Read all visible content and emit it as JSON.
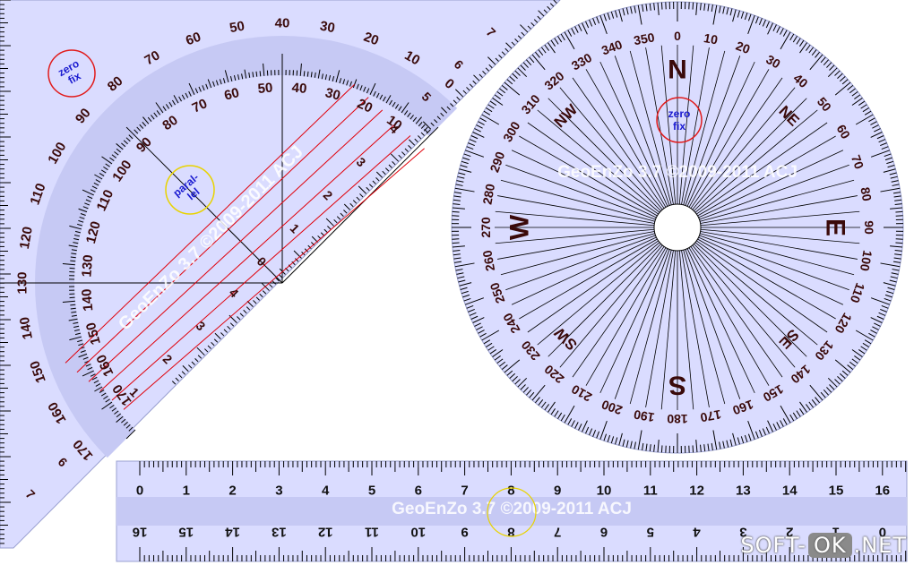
{
  "watermark": "GeoEnZo 3.7 ©2009-2011 ACJ",
  "site_badge": {
    "prefix": "SOFT-",
    "middle": "OK",
    "suffix": ".NET"
  },
  "buttons": {
    "zero_fix": [
      "zero",
      "fix"
    ],
    "parallel": [
      "paral-",
      "lel"
    ]
  },
  "compass": {
    "cardinals": [
      "N",
      "E",
      "S",
      "W"
    ],
    "intercardinals": [
      "NE",
      "SE",
      "SW",
      "NW"
    ],
    "degree_labels": [
      "0",
      "10",
      "20",
      "30",
      "40",
      "50",
      "60",
      "70",
      "80",
      "90",
      "100",
      "110",
      "120",
      "130",
      "140",
      "150",
      "160",
      "170",
      "180",
      "190",
      "200",
      "210",
      "220",
      "230",
      "240",
      "250",
      "260",
      "270",
      "280",
      "290",
      "300",
      "310",
      "320",
      "330",
      "340",
      "350"
    ]
  },
  "triangle": {
    "outer_scale": [
      "0",
      "10",
      "20",
      "30",
      "40",
      "50",
      "60",
      "70",
      "80",
      "90",
      "100",
      "110",
      "120",
      "130",
      "140",
      "150",
      "160",
      "170"
    ],
    "inner_scale": [
      "10",
      "20",
      "30",
      "40",
      "50",
      "60",
      "70",
      "80",
      "90",
      "100",
      "110",
      "120",
      "130",
      "140",
      "150",
      "160",
      "170"
    ],
    "edge_scale_top": [
      "7",
      "6",
      "5"
    ],
    "edge_scale_left": [
      "6",
      "7"
    ],
    "parallel_scale_a": [
      "0",
      "1",
      "2",
      "3",
      "4"
    ],
    "parallel_scale_b": [
      "1",
      "2",
      "3",
      "4"
    ]
  },
  "ruler": {
    "top_labels": [
      "0",
      "1",
      "2",
      "3",
      "4",
      "5",
      "6",
      "7",
      "8",
      "9",
      "10",
      "11",
      "12",
      "13",
      "14",
      "15",
      "16"
    ],
    "bottom_labels": [
      "16",
      "15",
      "14",
      "13",
      "12",
      "11",
      "10",
      "9",
      "8",
      "7",
      "6",
      "5",
      "4",
      "3",
      "2",
      "1",
      "0"
    ]
  },
  "colors": {
    "tool_fill": "#dadcff",
    "tool_band": "#c6c9f4",
    "tick": "#000000",
    "label_dark": "#3a0a0a",
    "red_line": "#e0000a",
    "zero_ring": "#e11b1b",
    "parallel_ring": "#e8d300",
    "ring_text": "#1a1ad0"
  }
}
